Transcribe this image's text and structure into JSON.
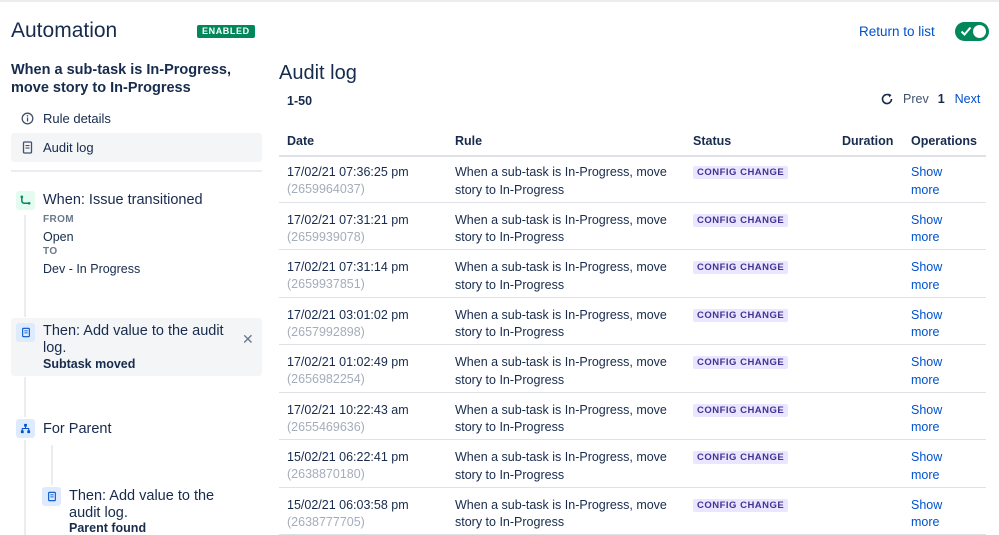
{
  "header": {
    "title": "Automation",
    "status_badge": "ENABLED",
    "return_link": "Return to list",
    "toggle_enabled": true
  },
  "sidebar": {
    "rule_name": "When a sub-task is In-Progress, move story to In-Progress",
    "nav": [
      {
        "label": "Rule details",
        "icon": "info-icon"
      },
      {
        "label": "Audit log",
        "icon": "document-icon"
      }
    ],
    "trigger": {
      "title": "When: Issue transitioned",
      "from_label": "FROM",
      "from_value": "Open",
      "to_label": "TO",
      "to_value": "Dev - In Progress"
    },
    "action1": {
      "title": "Then: Add value to the audit log.",
      "detail": "Subtask moved"
    },
    "branch": {
      "title": "For Parent"
    },
    "action2": {
      "title": "Then: Add value to the audit log.",
      "detail": "Parent found"
    }
  },
  "main": {
    "title": "Audit log",
    "range": "1-50",
    "pager": {
      "prev": "Prev",
      "current": "1",
      "next": "Next"
    },
    "columns": [
      "Date",
      "Rule",
      "Status",
      "Duration",
      "Operations"
    ],
    "rows": [
      {
        "date": "17/02/21 07:36:25 pm",
        "id": "(2659964037)",
        "rule": "When a sub-task is In-Progress, move story to In-Progress",
        "status": "CONFIG CHANGE",
        "duration": "",
        "ops": "Show more"
      },
      {
        "date": "17/02/21 07:31:21 pm",
        "id": "(2659939078)",
        "rule": "When a sub-task is In-Progress, move story to In-Progress",
        "status": "CONFIG CHANGE",
        "duration": "",
        "ops": "Show more"
      },
      {
        "date": "17/02/21 07:31:14 pm",
        "id": "(2659937851)",
        "rule": "When a sub-task is In-Progress, move story to In-Progress",
        "status": "CONFIG CHANGE",
        "duration": "",
        "ops": "Show more"
      },
      {
        "date": "17/02/21 03:01:02 pm",
        "id": "(2657992898)",
        "rule": "When a sub-task is In-Progress, move story to In-Progress",
        "status": "CONFIG CHANGE",
        "duration": "",
        "ops": "Show more"
      },
      {
        "date": "17/02/21 01:02:49 pm",
        "id": "(2656982254)",
        "rule": "When a sub-task is In-Progress, move story to In-Progress",
        "status": "CONFIG CHANGE",
        "duration": "",
        "ops": "Show more"
      },
      {
        "date": "17/02/21 10:22:43 am",
        "id": "(2655469636)",
        "rule": "When a sub-task is In-Progress, move story to In-Progress",
        "status": "CONFIG CHANGE",
        "duration": "",
        "ops": "Show more"
      },
      {
        "date": "15/02/21 06:22:41 pm",
        "id": "(2638870180)",
        "rule": "When a sub-task is In-Progress, move story to In-Progress",
        "status": "CONFIG CHANGE",
        "duration": "",
        "ops": "Show more"
      },
      {
        "date": "15/02/21 06:03:58 pm",
        "id": "(2638777705)",
        "rule": "When a sub-task is In-Progress, move story to In-Progress",
        "status": "CONFIG CHANGE",
        "duration": "",
        "ops": "Show more"
      }
    ]
  },
  "colors": {
    "accent": "#0052cc",
    "enabled_green": "#00875a",
    "status_bg": "#eae6ff",
    "status_text": "#403294",
    "muted_id": "#a5adba"
  }
}
